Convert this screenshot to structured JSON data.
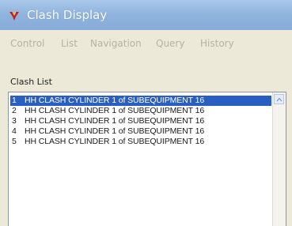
{
  "window": {
    "title": "Clash Display",
    "icon": "app-icon-red"
  },
  "menu": {
    "items": [
      "Control",
      "List",
      "Navigation",
      "Query",
      "History"
    ]
  },
  "clash_list": {
    "label": "Clash List",
    "selected_index": 0,
    "items": [
      {
        "num": "1",
        "text": "HH CLASH CYLINDER 1 of SUBEQUIPMENT 16"
      },
      {
        "num": "2",
        "text": "HH CLASH CYLINDER 1 of SUBEQUIPMENT 16"
      },
      {
        "num": "3",
        "text": "HH CLASH CYLINDER 1 of SUBEQUIPMENT 16"
      },
      {
        "num": "4",
        "text": "HH CLASH CYLINDER 1 of SUBEQUIPMENT 16"
      },
      {
        "num": "5",
        "text": "HH CLASH CYLINDER 1 of SUBEQUIPMENT 16"
      }
    ]
  },
  "colors": {
    "selection": "#2a5fc2",
    "titlebar": "#8fb3dd",
    "menu_disabled": "#b7b2a3"
  }
}
